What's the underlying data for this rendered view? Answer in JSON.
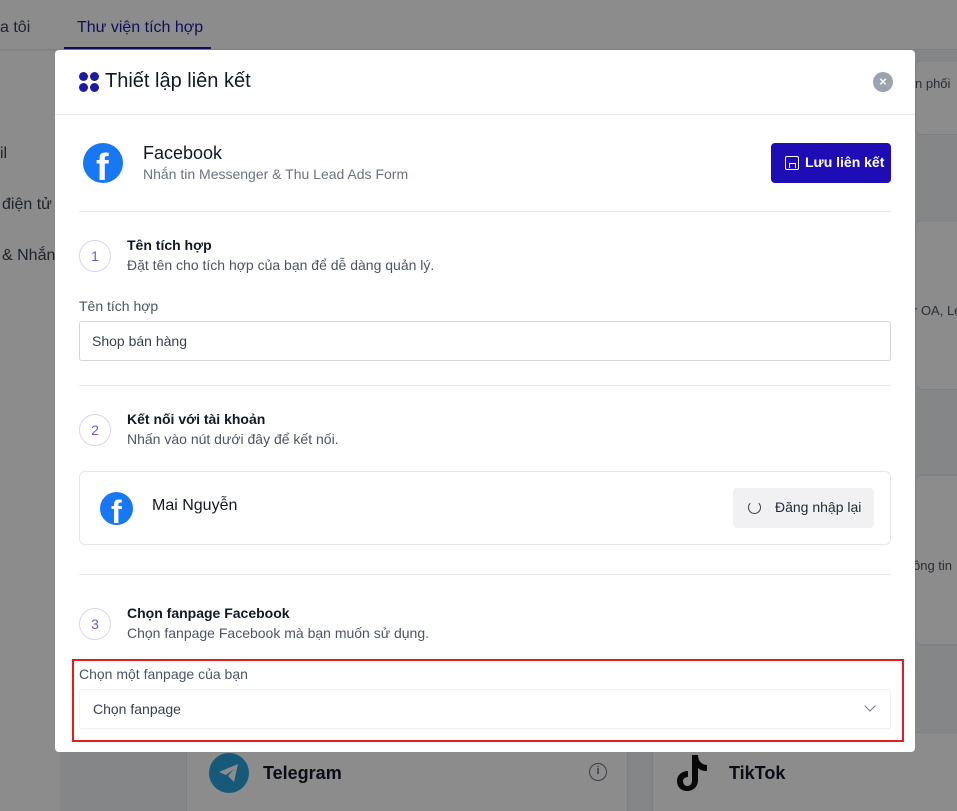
{
  "background": {
    "tabs": [
      {
        "label": "a tôi"
      },
      {
        "label": "Thư viện tích hợp"
      }
    ],
    "sidebar": [
      {
        "label": "il"
      },
      {
        "label": "điện tử"
      },
      {
        "label": "& Nhắn"
      }
    ],
    "right_fragments": [
      {
        "label": "n phối"
      },
      {
        "label": "r OA, Le"
      },
      {
        "label": "ông tin"
      }
    ],
    "cards": [
      {
        "title": "Telegram",
        "info": "i"
      },
      {
        "title": "TikTok"
      }
    ]
  },
  "modal": {
    "title": "Thiết lập liên kết",
    "close": "×",
    "app": {
      "name": "Facebook",
      "description": "Nhắn tin Messenger & Thu Lead Ads Form",
      "save_label": "Lưu liên kết"
    },
    "steps": [
      {
        "number": "1",
        "title": "Tên tích hợp",
        "description": "Đặt tên cho tích hợp của bạn để dễ dàng quản lý.",
        "field_label": "Tên tích hợp",
        "field_value": "Shop bán hàng"
      },
      {
        "number": "2",
        "title": "Kết nối với tài khoản",
        "description": "Nhấn vào nút dưới đây để kết nối.",
        "account_name": "Mai Nguyễn",
        "relogin_label": "Đăng nhập lại"
      },
      {
        "number": "3",
        "title": "Chọn fanpage Facebook",
        "description": "Chọn fanpage Facebook mà bạn muốn sử dụng.",
        "field_label": "Chọn một fanpage của bạn",
        "select_value": "Chọn fanpage"
      }
    ]
  },
  "colors": {
    "brand": "#1e0db5",
    "facebook": "#1877f2",
    "highlight": "#e11d1d"
  }
}
